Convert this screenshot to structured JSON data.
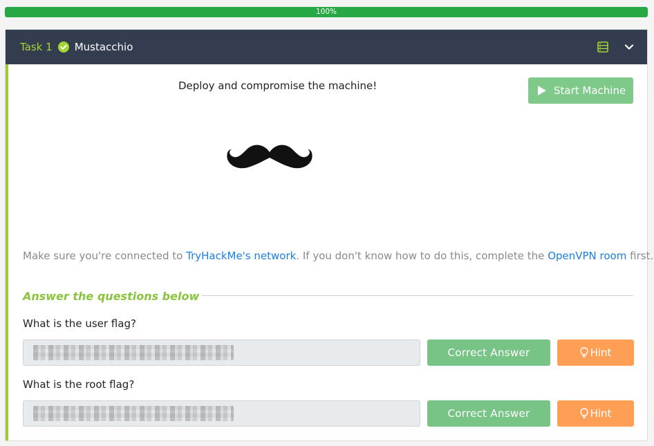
{
  "progress": {
    "percent_label": "100%",
    "value": 100,
    "color": "#28a745"
  },
  "task": {
    "label": "Task 1",
    "title": "Mustacchio",
    "completed": true,
    "header_bg": "#343d4f",
    "accent": "#a3d533",
    "icons": {
      "status": "check-circle-icon",
      "toggle_view": "server-icon",
      "collapse": "chevron-down-icon"
    }
  },
  "body": {
    "instruction": "Deploy and compromise the machine!",
    "start_machine_label": "Start Machine",
    "start_machine_color": "#7fc98a",
    "image_alt_icon": "mustache-icon",
    "connect_prefix": "Make sure you're connected to ",
    "connect_link1": "TryHackMe's network",
    "connect_middle": ". If you don't know how to do this, complete the ",
    "connect_link2": "OpenVPN room",
    "connect_suffix": " first."
  },
  "answers": {
    "heading": "Answer the questions below",
    "questions": [
      {
        "text": "What is the user flag?",
        "answer_state": "blurred",
        "correct_label": "Correct Answer",
        "hint_label": "Hint"
      },
      {
        "text": "What is the root flag?",
        "answer_state": "blurred",
        "correct_label": "Correct Answer",
        "hint_label": "Hint"
      }
    ],
    "colors": {
      "correct": "#77c486",
      "hint": "#ff9e55",
      "heading": "#8ac43f",
      "link": "#1a7fe0"
    }
  }
}
